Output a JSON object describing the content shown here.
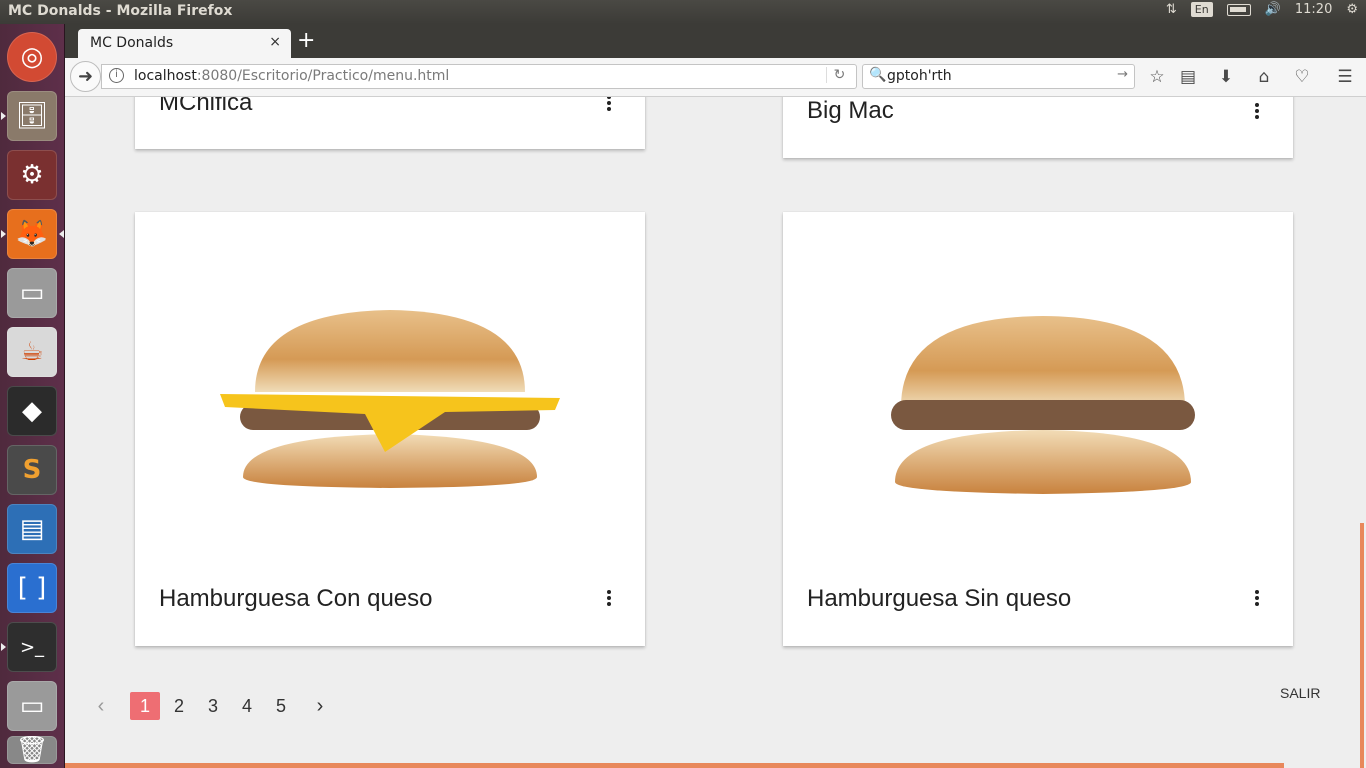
{
  "os": {
    "window_title": "MC Donalds - Mozilla Firefox",
    "keyboard_layout": "En",
    "clock": "11:20"
  },
  "launcher": {
    "items": [
      {
        "name": "ubuntu-dash",
        "color": "#d24a33"
      },
      {
        "name": "files",
        "color": "#8a7a6a"
      },
      {
        "name": "system-settings",
        "color": "#8b3a3a"
      },
      {
        "name": "firefox",
        "color": "#e76f1d"
      },
      {
        "name": "drive",
        "color": "#9a9a9a"
      },
      {
        "name": "java",
        "color": "#d9d9d9"
      },
      {
        "name": "inkscape",
        "color": "#2b2b2b"
      },
      {
        "name": "sublime-text",
        "color": "#4a4a4a"
      },
      {
        "name": "libreoffice-writer",
        "color": "#2d6fb6"
      },
      {
        "name": "brackets",
        "color": "#2a6fd0"
      },
      {
        "name": "terminal",
        "color": "#2e2e2e"
      },
      {
        "name": "drive-2",
        "color": "#9a9a9a"
      },
      {
        "name": "trash",
        "color": "#888"
      }
    ]
  },
  "browser": {
    "tab_title": "MC Donalds",
    "tab_close": "×",
    "new_tab": "+",
    "url_host": "localhost",
    "url_rest": ":8080/Escritorio/Practico/menu.html",
    "search_value": "gptoh'rth"
  },
  "page": {
    "cards": [
      {
        "title": "MChifica"
      },
      {
        "title": "Big Mac"
      },
      {
        "title": "Hamburguesa Con queso"
      },
      {
        "title": "Hamburguesa Sin queso"
      }
    ],
    "pagination": {
      "prev": "‹",
      "next": "›",
      "pages": [
        "1",
        "2",
        "3",
        "4",
        "5"
      ],
      "active": "1"
    },
    "salir_label": "SALIR"
  },
  "colors": {
    "accent": "#ee6e73",
    "strip": "#e8885b",
    "background": "#eeeeee"
  }
}
